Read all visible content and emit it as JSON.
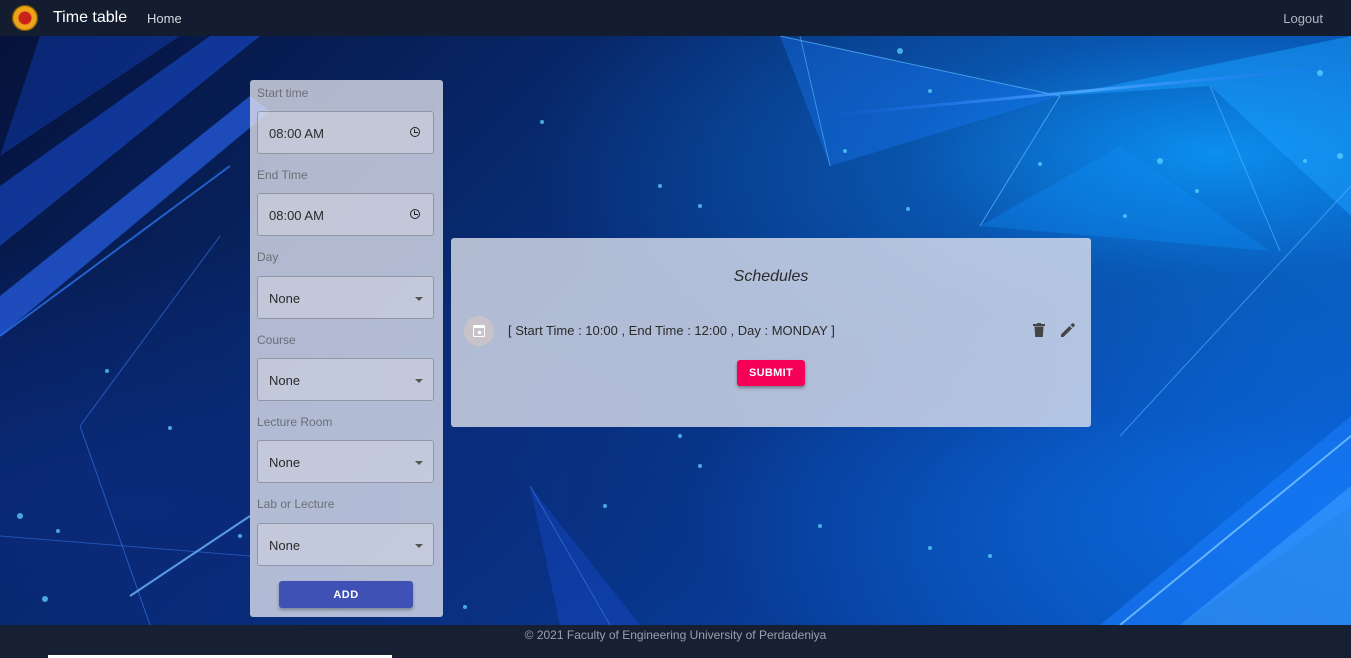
{
  "header": {
    "brand": "Time table",
    "home": "Home",
    "logout": "Logout"
  },
  "form": {
    "start_time_label": "Start time",
    "start_time_value": "08:00 AM",
    "end_time_label": "End Time",
    "end_time_value": "08:00 AM",
    "day_label": "Day",
    "day_value": "None",
    "course_label": "Course",
    "course_value": "None",
    "room_label": "Lecture Room",
    "room_value": "None",
    "type_label": "Lab or Lecture",
    "type_value": "None",
    "add_label": "ADD"
  },
  "schedules": {
    "title": "Schedules",
    "items": [
      {
        "text": "[ Start Time : 10:00 , End Time : 12:00 , Day : MONDAY ]"
      }
    ],
    "submit_label": "SUBMIT"
  },
  "footer": {
    "text": "© 2021 Faculty of Engineering University of Perdadeniya"
  },
  "colors": {
    "add_button": "#3f51b5",
    "submit_button": "#f50057",
    "navbar": "#141d30"
  }
}
